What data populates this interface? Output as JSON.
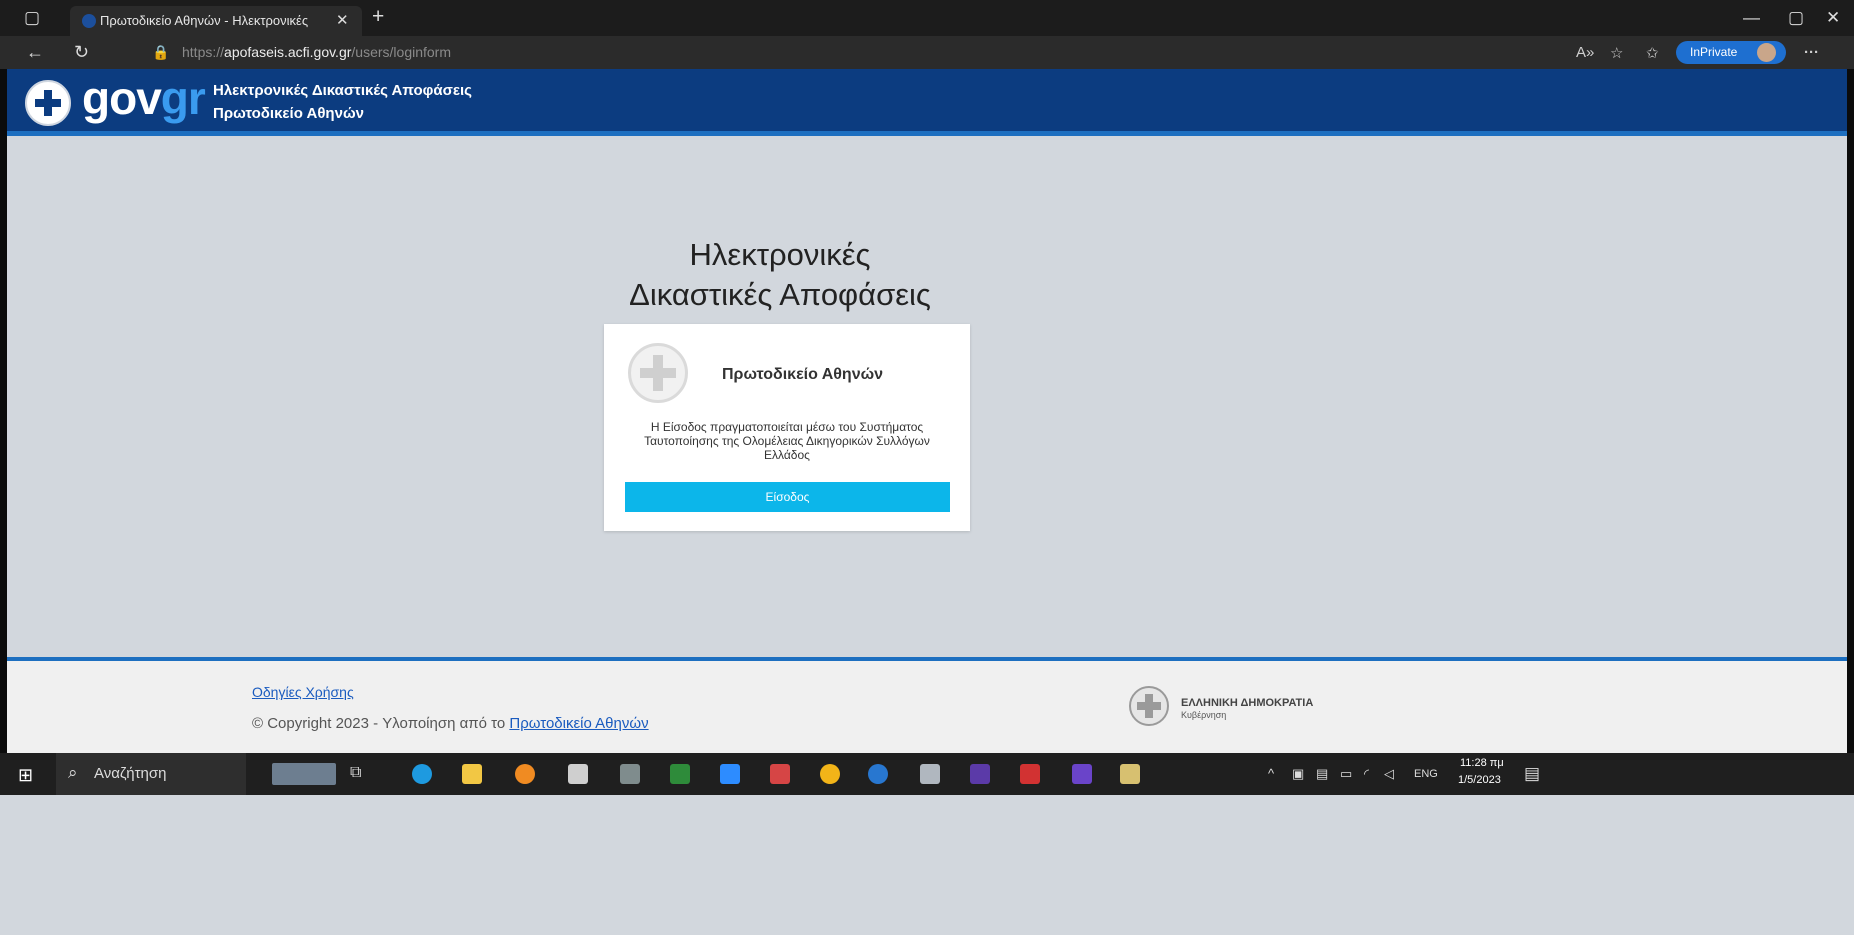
{
  "browser": {
    "tab_title": "Πρωτοδικείο Αθηνών - Ηλεκτρονικές",
    "url_prefix": "https://",
    "url_host": "apofaseis.acfi.gov.gr",
    "url_path": "/users/loginform",
    "inprivate_label": "InPrivate",
    "icons": [
      "tab-actions-icon",
      "close-tab-icon",
      "new-tab-icon",
      "minimize-icon",
      "restore-icon",
      "close-window-icon",
      "back-icon",
      "refresh-icon",
      "lock-icon",
      "read-aloud-icon",
      "add-favorite-icon",
      "favorites-icon",
      "collections-icon",
      "more-icon"
    ]
  },
  "header": {
    "logo_main": "gov",
    "logo_accent": "gr",
    "title": "Ηλεκτρονικές Δικαστικές Αποφάσεις",
    "subtitle": "Πρωτοδικείο Αθηνών",
    "bg_color": "#0c3c80",
    "accent_color": "#3a9bef"
  },
  "main": {
    "title_line1": "Ηλεκτρονικές",
    "title_line2": "Δικαστικές Αποφάσεις"
  },
  "card": {
    "court_name": "Πρωτοδικείο Αθηνών",
    "description": "Η Είσοδος πραγματοποιείται μέσω του Συστήματος Ταυτοποίησης της Ολομέλειας Δικηγορικών Συλλόγων Ελλάδος",
    "login_button": "Είσοδος",
    "button_color": "#0cb6ea"
  },
  "footer": {
    "help_link": "Οδηγίες Χρήσης",
    "copyright_prefix": "© Copyright 2023 - Υλοποίηση από το",
    "copyright_link": "Πρωτοδικείο Αθηνών",
    "republic": "ΕΛΛΗΝΙΚΗ ΔΗΜΟΚΡΑΤΙΑ",
    "government": "Κυβέρνηση"
  },
  "taskbar": {
    "search_placeholder": "Αναζήτηση",
    "language": "ENG",
    "time": "11:28 πμ",
    "date": "1/5/2023"
  }
}
